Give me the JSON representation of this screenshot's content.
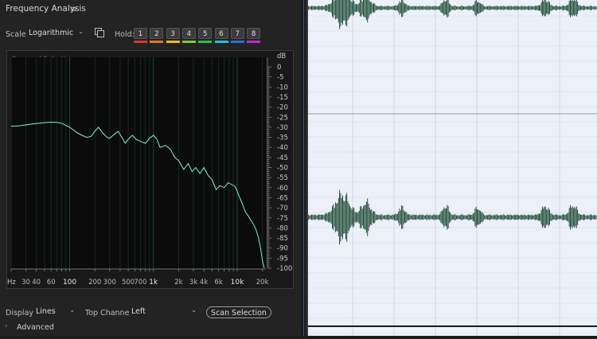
{
  "panel": {
    "title": "Frequency Analysis",
    "menu_icon": "hamburger-menu-icon",
    "scale_label": "Scale:",
    "scale_value": "Logarithmic",
    "copy_icon": "copy-icon",
    "hold_label": "Hold:",
    "hold_buttons": [
      "1",
      "2",
      "3",
      "4",
      "5",
      "6",
      "7",
      "8"
    ],
    "hold_colors": [
      "#e0352b",
      "#e07a1f",
      "#e0c21f",
      "#7ecf2a",
      "#2ac24a",
      "#22c6d6",
      "#2a6ee0",
      "#c22ad0"
    ]
  },
  "plot": {
    "overlay_label": "Scanned Selection",
    "db_unit": "dB",
    "db_ticks": [
      "0",
      "-5",
      "-10",
      "-15",
      "-20",
      "-25",
      "-30",
      "-35",
      "-40",
      "-45",
      "-50",
      "-55",
      "-60",
      "-65",
      "-70",
      "-75",
      "-80",
      "-85",
      "-90",
      "-95",
      "-100"
    ],
    "hz_unit": "Hz",
    "hz_ticks": [
      "30",
      "40",
      "60",
      "100",
      "200",
      "300",
      "500",
      "700",
      "1k",
      "2k",
      "3k",
      "4k",
      "6k",
      "10k",
      "20k"
    ],
    "hz_values": [
      30,
      40,
      60,
      100,
      200,
      300,
      500,
      700,
      1000,
      2000,
      3000,
      4000,
      6000,
      10000,
      20000
    ],
    "line_color": "#7ff5c8"
  },
  "chart_data": {
    "type": "line",
    "xlabel": "Hz",
    "ylabel": "dB",
    "x_scale": "log",
    "xlim": [
      20,
      22000
    ],
    "ylim": [
      -100,
      0
    ],
    "series": [
      {
        "x": [
          20,
          25,
          30,
          40,
          50,
          60,
          70,
          80,
          100,
          120,
          140,
          160,
          180,
          200,
          220,
          250,
          280,
          300,
          340,
          380,
          420,
          460,
          500,
          560,
          620,
          700,
          800,
          900,
          1000,
          1100,
          1200,
          1400,
          1600,
          1800,
          2000,
          2300,
          2600,
          2900,
          3200,
          3600,
          4000,
          4500,
          5000,
          5600,
          6200,
          7000,
          7800,
          8600,
          9500,
          10500,
          11500,
          12500,
          13500,
          15000,
          16500,
          18000,
          19000,
          20000,
          21000
        ],
        "y": [
          -29.5,
          -29.3,
          -28.8,
          -28.2,
          -27.7,
          -27.5,
          -27.6,
          -28.0,
          -30,
          -32.5,
          -34,
          -35,
          -34.5,
          -32,
          -30,
          -33,
          -35,
          -35.5,
          -33.5,
          -32,
          -35,
          -38,
          -36,
          -34,
          -36,
          -37,
          -38,
          -35.5,
          -34,
          -36,
          -40,
          -39,
          -41,
          -45,
          -46.5,
          -51,
          -48,
          -52,
          -50,
          -53,
          -50,
          -54,
          -56,
          -61,
          -59,
          -60,
          -57.5,
          -58.5,
          -59.5,
          -64,
          -68,
          -72,
          -74,
          -77,
          -80,
          -85,
          -90,
          -96,
          -100
        ]
      }
    ]
  },
  "footer": {
    "display_label": "Display:",
    "display_value": "Lines",
    "top_channel_label": "Top Channel:",
    "top_channel_value": "Left",
    "scan_button": "Scan Selection",
    "advanced_label": "Advanced",
    "advanced_icon": "chevron-right-icon"
  },
  "waveform": {
    "wave_color": "#234f3a",
    "center_line_color": "#9a9a9a",
    "grid_color": "#cfd6e8",
    "background": "#ecf0f9"
  }
}
